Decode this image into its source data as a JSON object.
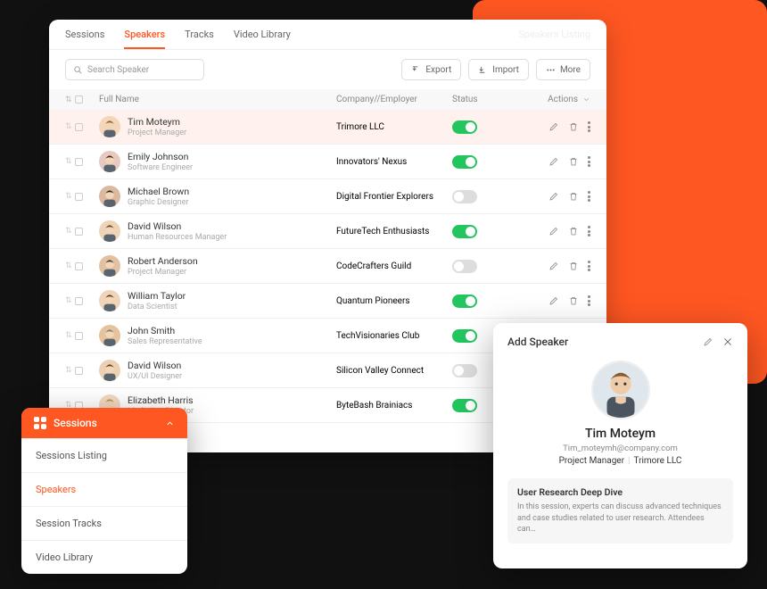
{
  "tabs": [
    "Sessions",
    "Speakers",
    "Tracks",
    "Video Library"
  ],
  "activeTab": 1,
  "ghostTitle": "Speakers Listing",
  "search": {
    "placeholder": "Search Speaker"
  },
  "toolbar": {
    "export": "Export",
    "import": "Import",
    "more": "More"
  },
  "columns": {
    "fullName": "Full Name",
    "company": "Company//Employer",
    "status": "Status",
    "actions": "Actions"
  },
  "speakers": [
    {
      "name": "Tim Moteym",
      "role": "Project Manager",
      "company": "Trimore LLC",
      "on": true,
      "selected": true,
      "bg": "#f4d6b8",
      "hair": "#8a5a2e"
    },
    {
      "name": "Emily Johnson",
      "role": "Software Engineer",
      "company": "Innovators' Nexus",
      "on": true,
      "bg": "#e8c9c0",
      "hair": "#3a2a1f"
    },
    {
      "name": "Michael Brown",
      "role": "Graphic Designer",
      "company": "Digital Frontier Explorers",
      "on": false,
      "bg": "#dcb89e",
      "hair": "#2b2b2b"
    },
    {
      "name": "David Wilson",
      "role": "Human Resources Manager",
      "company": "FutureTech Enthusiasts",
      "on": true,
      "bg": "#efd3b6",
      "hair": "#6b4423"
    },
    {
      "name": "Robert Anderson",
      "role": "Project Manager",
      "company": "CodeCrafters Guild",
      "on": false,
      "bg": "#e2c1a3",
      "hair": "#4a3a2a"
    },
    {
      "name": "William Taylor",
      "role": "Data Scientist",
      "company": "Quantum Pioneers",
      "on": true,
      "bg": "#f0d4ba",
      "hair": "#553c26"
    },
    {
      "name": "John Smith",
      "role": "Sales Representative",
      "company": "TechVisionaries Club",
      "on": true,
      "bg": "#e6c39f",
      "hair": "#7a7a7a"
    },
    {
      "name": "David Wilson",
      "role": "UX/UI Designer",
      "company": "Silicon Valley Connect",
      "on": false,
      "bg": "#edd0b3",
      "hair": "#5a3e28"
    },
    {
      "name": "Elizabeth Harris",
      "role": "Marketing Director",
      "company": "ByteBash Brainiacs",
      "on": true,
      "bg": "#f2d8c2",
      "hair": "#b58b5a"
    }
  ],
  "sidebar": {
    "title": "Sessions",
    "items": [
      {
        "label": "Sessions Listing",
        "active": false
      },
      {
        "label": "Speakers",
        "active": true
      },
      {
        "label": "Session Tracks",
        "active": false
      },
      {
        "label": "Video Library",
        "active": false
      }
    ]
  },
  "addPanel": {
    "title": "Add Speaker",
    "name": "Tim Moteym",
    "email": "Tim_moteymh@company.com",
    "job": "Project Manager",
    "company": "Trimore LLC",
    "session": {
      "title": "User Research Deep Dive",
      "desc": "In this session, experts can discuss advanced techniques and case studies related to user research. Attendees can…"
    }
  }
}
